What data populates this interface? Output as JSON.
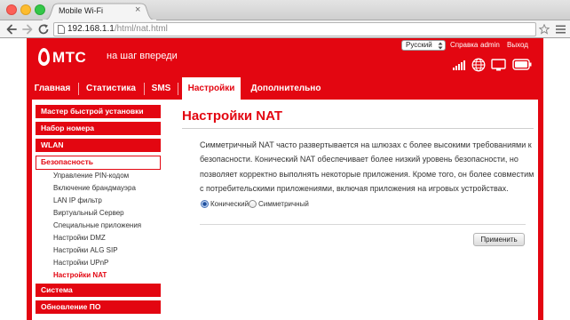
{
  "browser": {
    "tab_title": "Mobile Wi-Fi",
    "url_host": "192.168.1.1",
    "url_path": "/html/nat.html"
  },
  "header": {
    "logo_text": "МТС",
    "slogan": "на шаг впереди",
    "language": "Русский",
    "help_link": "Справка",
    "user": "admin",
    "logout_link": "Выход",
    "status_icons": [
      "signal-strength-icon",
      "internet-globe-icon",
      "monitor-icon",
      "battery-icon"
    ]
  },
  "nav": {
    "items": [
      {
        "label": "Главная",
        "active": false
      },
      {
        "label": "Статистика",
        "active": false
      },
      {
        "label": "SMS",
        "active": false
      },
      {
        "label": "Настройки",
        "active": true
      },
      {
        "label": "Дополнительно",
        "active": false
      }
    ]
  },
  "sidebar": {
    "sections": [
      {
        "label": "Мастер быстрой установки"
      },
      {
        "label": "Набор номера"
      },
      {
        "label": "WLAN"
      },
      {
        "label": "Безопасность",
        "expanded": true,
        "items": [
          {
            "label": "Управление PIN-кодом",
            "active": false
          },
          {
            "label": "Включение брандмауэра",
            "active": false
          },
          {
            "label": "LAN IP фильтр",
            "active": false
          },
          {
            "label": "Виртуальный Сервер",
            "active": false
          },
          {
            "label": "Специальные приложения",
            "active": false
          },
          {
            "label": "Настройки DMZ",
            "active": false
          },
          {
            "label": "Настройки ALG SIP",
            "active": false
          },
          {
            "label": "Настройки UPnP",
            "active": false
          },
          {
            "label": "Настройки NAT",
            "active": true
          }
        ]
      },
      {
        "label": "Система"
      },
      {
        "label": "Обновление ПО"
      }
    ]
  },
  "main": {
    "title": "Настройки NAT",
    "description_lines": [
      "Симметричный NAT часто развертывается на шлюзах с более высокими требованиями к",
      "безопасности. Конический NAT обеспечивает более низкий уровень безопасности, но",
      "позволяет корректно выполнять некоторые приложения. Кроме того, он более совместим",
      "с потребительскими приложениями, включая приложения на игровых устройствах."
    ],
    "nat_type_options": [
      {
        "label": "Конический",
        "checked": true
      },
      {
        "label": "Симметричный",
        "checked": false
      }
    ],
    "apply_button": "Применить"
  },
  "colors": {
    "brand_red": "#e30611",
    "text": "#333333"
  }
}
